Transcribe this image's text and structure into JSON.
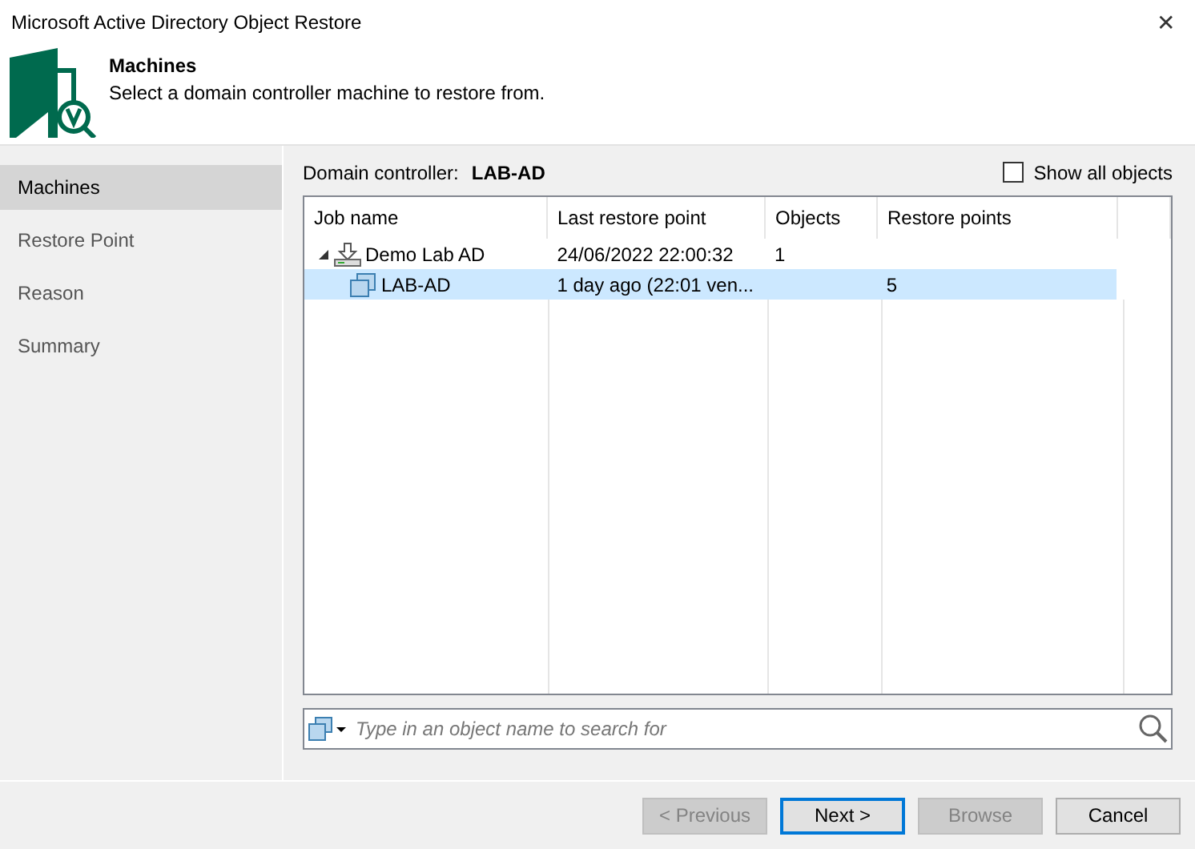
{
  "window": {
    "title": "Microsoft Active Directory Object Restore",
    "close": "✕"
  },
  "header": {
    "title": "Machines",
    "subtitle": "Select a domain controller machine to restore from."
  },
  "steps": [
    {
      "label": "Machines",
      "selected": true
    },
    {
      "label": "Restore Point",
      "selected": false
    },
    {
      "label": "Reason",
      "selected": false
    },
    {
      "label": "Summary",
      "selected": false
    }
  ],
  "domain_controller": {
    "label": "Domain controller:",
    "value": "LAB-AD"
  },
  "show_all_objects": {
    "label": "Show all objects",
    "checked": false
  },
  "table": {
    "columns": [
      "Job name",
      "Last restore point",
      "Objects",
      "Restore points"
    ],
    "rows": [
      {
        "kind": "job",
        "cells": [
          "Demo Lab AD",
          "24/06/2022 22:00:32",
          "1",
          ""
        ],
        "expanded": true,
        "selected": false,
        "children": [
          {
            "kind": "machine",
            "cells": [
              "LAB-AD",
              "1 day ago (22:01 ven...",
              "",
              "5"
            ],
            "selected": true
          }
        ]
      }
    ]
  },
  "search": {
    "placeholder": "Type in an object name to search for"
  },
  "buttons": [
    {
      "label": "< Previous",
      "disabled": true,
      "default": false
    },
    {
      "label": "Next >",
      "disabled": false,
      "default": true
    },
    {
      "label": "Browse",
      "disabled": true,
      "default": false
    },
    {
      "label": "Cancel",
      "disabled": false,
      "default": false
    }
  ]
}
